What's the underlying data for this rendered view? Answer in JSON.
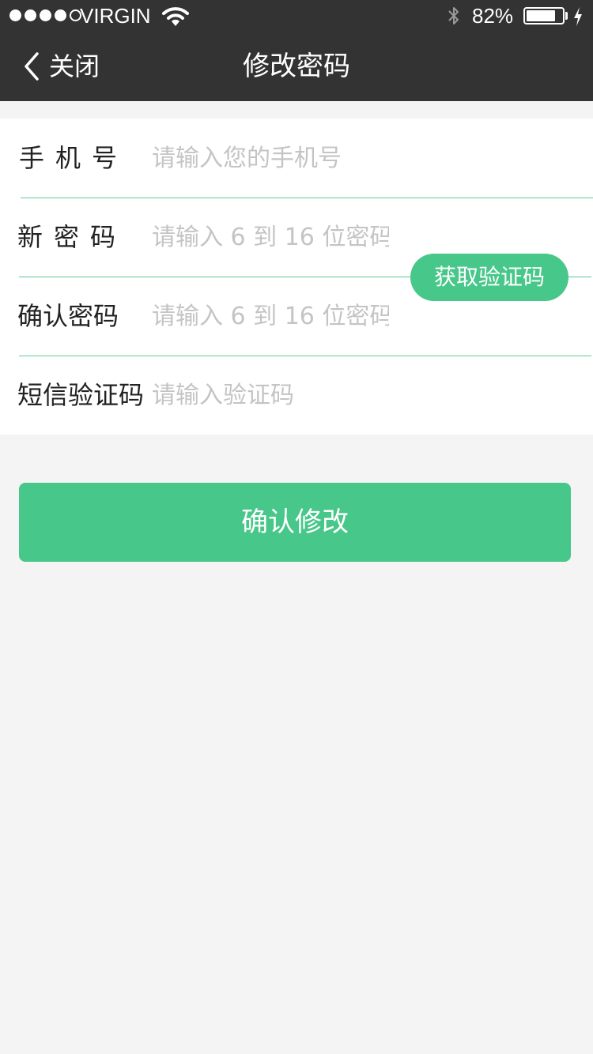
{
  "status_bar": {
    "carrier": "VIRGIN",
    "signal_bars_filled": 4,
    "signal_bars_total": 5,
    "battery_percent_label": "82%",
    "battery_level": 0.82
  },
  "nav": {
    "back_label": "关闭",
    "title": "修改密码"
  },
  "form": {
    "phone": {
      "label": "手机号",
      "placeholder": "请输入您的手机号",
      "value": ""
    },
    "new_password": {
      "label": "新密码",
      "placeholder": "请输入 6 到 16 位密码",
      "value": ""
    },
    "confirm_password": {
      "label": "确认密码",
      "placeholder": "请输入 6 到 16 位密码",
      "value": ""
    },
    "sms_code": {
      "label": "短信验证码",
      "placeholder": "请输入验证码",
      "value": ""
    },
    "get_code_label": "获取验证码"
  },
  "submit_label": "确认修改",
  "colors": {
    "accent": "#48c78a",
    "header_bg": "#333333",
    "page_bg": "#f4f4f4",
    "placeholder": "#c4c4c4"
  },
  "icons": {
    "back": "chevron-left-icon",
    "wifi": "wifi-icon",
    "bluetooth": "bluetooth-icon",
    "battery": "battery-icon",
    "charging": "lightning-bolt-icon"
  }
}
